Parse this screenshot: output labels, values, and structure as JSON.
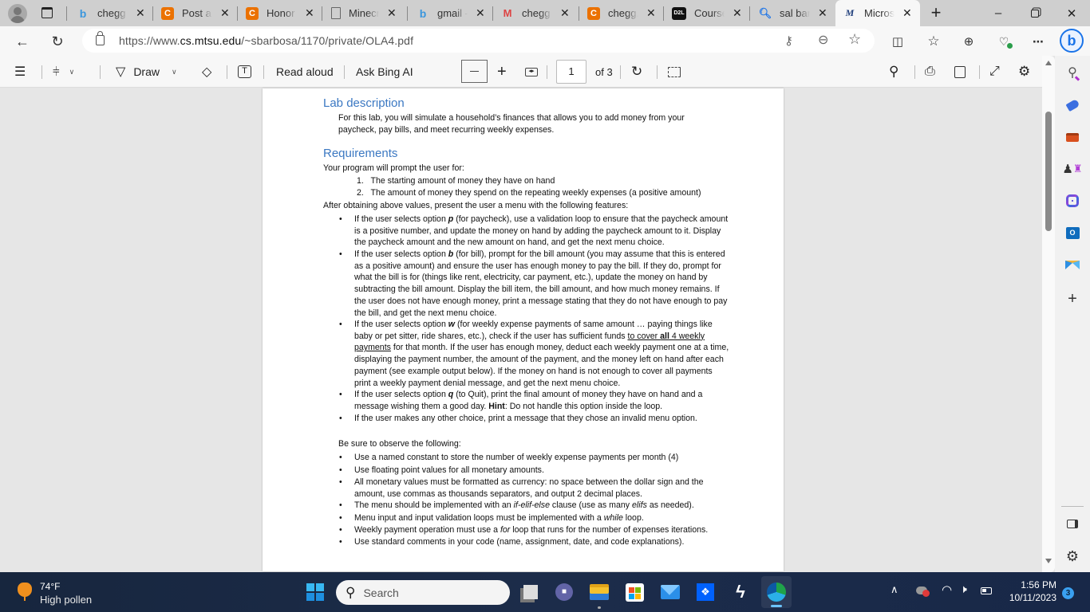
{
  "browser": {
    "tabs": [
      {
        "label": "chegg -",
        "favicon": "bing-icon",
        "active": false
      },
      {
        "label": "Post a n",
        "favicon": "chegg-icon",
        "active": false
      },
      {
        "label": "Honor C",
        "favicon": "chegg-icon",
        "active": false
      },
      {
        "label": "Minecra",
        "favicon": "document-icon",
        "active": false
      },
      {
        "label": "gmail -",
        "favicon": "bing-icon",
        "active": false
      },
      {
        "label": "chegg -",
        "favicon": "gmail-icon",
        "active": false
      },
      {
        "label": "chegg.c",
        "favicon": "chegg-icon",
        "active": false
      },
      {
        "label": "Course",
        "favicon": "d2l-icon",
        "active": false
      },
      {
        "label": "sal barb",
        "favicon": "search-icon",
        "active": false
      },
      {
        "label": "Microso",
        "favicon": "mtsu-icon",
        "active": true
      }
    ],
    "d2l_text": "D2L",
    "chegg_letter": "C",
    "url_prefix": "https://www.",
    "url_domain": "cs.mtsu.edu",
    "url_path": "/~sbarbosa/1170/private/OLA4.pdf"
  },
  "pdf_toolbar": {
    "draw_label": "Draw",
    "read_aloud_label": "Read aloud",
    "ask_bing_label": "Ask Bing AI",
    "page_number": "1",
    "page_total": "of 3"
  },
  "document": {
    "lab_heading": "Lab description",
    "lab_text_1": "For this lab, you will simulate a household’s finances that allows you to add money from your",
    "lab_text_2": "paycheck, pay bills, and meet recurring weekly expenses.",
    "req_heading": "Requirements",
    "prompt_intro": "Your program will prompt the user for:",
    "numbered": [
      {
        "num": "1.",
        "text": "The starting amount of money they have on hand"
      },
      {
        "num": "2.",
        "text": "The amount of money they spend on the repeating weekly expenses (a positive amount)"
      }
    ],
    "menu_intro": "After obtaining above values, present the user a menu with the following features:",
    "menu_items": {
      "p": {
        "a": "If the user selects option ",
        "opt": "p",
        "b": " (for paycheck), use a validation loop to ensure that the paycheck amount is a positive number, and update the money on hand by adding the paycheck amount to it.  Display the paycheck amount and the new amount on hand, and get the next menu choice."
      },
      "b": {
        "a": "If the user selects option ",
        "opt": "b",
        "b": " (for bill), prompt for the bill amount (you may assume that this is entered as a positive amount) and ensure the user has enough money to pay the bill. If they do, prompt for what the bill is for (things like rent, electricity, car payment, etc.), update the money on hand by subtracting the bill amount. Display the bill item, the bill amount, and how much money remains.  If the user does not have enough money, print a message stating that they do not have enough to pay the bill, and get the next menu choice."
      },
      "w": {
        "a": "If the user selects option ",
        "opt": "w",
        "b": " (for weekly expense payments of same amount … paying things like baby or pet sitter, ride shares, etc.), check if the user has sufficient funds ",
        "u1": "to cover ",
        "u2": "all",
        "u3": " 4 weekly payments",
        "c": " for that month.  If the user has enough money, deduct each weekly payment one at a time, displaying the payment number, the amount of the payment, and the money left on hand after each payment (see example output below).  If the money on hand is not enough to cover all payments print a weekly payment denial message, and get the next menu choice."
      },
      "q": {
        "a": "If the user selects option ",
        "opt": "q",
        "b": " (to Quit), print the final amount of money they have on hand and a message wishing them a good day.  ",
        "hint": "Hint",
        "c": ": Do not handle this option inside the loop."
      },
      "other": "If the user makes any other choice, print a message that they chose an invalid menu option."
    },
    "observe_intro": "Be sure to observe the following:",
    "observe": {
      "o1": "Use a named constant to store the number of weekly expense payments per month (4)",
      "o2": "Use floating point values for all monetary amounts.",
      "o3": "All monetary values must be formatted as currency: no space between the dollar sign and the amount, use commas as thousands separators, and output 2 decimal places.",
      "o4a": "The menu should be implemented with an ",
      "o4i": "if-elif-else",
      "o4b": " clause (use as many ",
      "o4i2": "elifs",
      "o4c": " as needed).",
      "o5a": "Menu input and input validation loops must be implemented with a ",
      "o5i": "while",
      "o5b": " loop.",
      "o6a": "Weekly payment operation must use a ",
      "o6i": "for",
      "o6b": " loop that runs for the number of expenses iterations.",
      "o7": "Use standard comments in your code (name, assignment, date, and code explanations)."
    }
  },
  "taskbar": {
    "weather_temp": "74°F",
    "weather_desc": "High pollen",
    "search_placeholder": "Search",
    "time": "1:56 PM",
    "date": "10/11/2023",
    "notification_count": "3"
  }
}
